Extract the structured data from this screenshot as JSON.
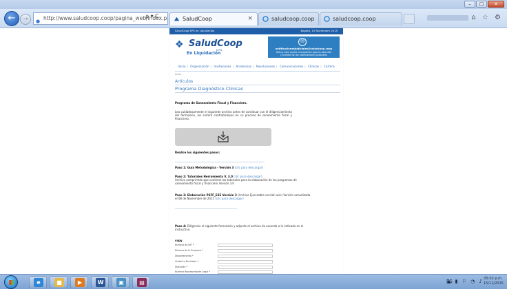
{
  "browser": {
    "address": "http://www.saludcoop.coop/pagina_web/index.php?o",
    "address_domain": "saludcoop.coop",
    "addr_actions": "ρ ▾ C",
    "tabs": [
      {
        "label": "SaludCoop",
        "active": true
      },
      {
        "label": "saludcoop.coop",
        "active": false
      },
      {
        "label": "saludcoop.coop",
        "active": false
      }
    ],
    "window_buttons": {
      "minimize": "–",
      "maximize": "□",
      "close": "✕"
    },
    "toolbar_icons": "⌂ ☆ ⚙"
  },
  "site": {
    "topbar_left": "SaludCoop EPS en Liquidación",
    "topbar_right": "Bogotá, 15 Noviembre 2015",
    "logo_text": "SaludCoop",
    "logo_eps": "E.P.S.",
    "liquidacion": "En Liquidación",
    "notice": {
      "icon": "✉",
      "line1": "notificacionesjudiciales@saludcoop.coop",
      "line2": "Utilice este correo únicamente para la atención",
      "line3": "y trámite de las notificaciones judiciales"
    },
    "nav": [
      "Inicio",
      "Organización",
      "Invitaciones",
      "Acreencias",
      "Resoluciones",
      "Comunicaciones",
      "Clínicas",
      "Cartera"
    ],
    "breadcrumb": "Inicio",
    "section_title": "Artículos",
    "article_title": "Programa Diagnóstico Clínicas",
    "subtitle": "Programa de Saneamiento Fiscal y Financiero.",
    "intro": "Lea cuidadosamente el siguiente archivo antes de continuar con el diligenciamiento del formulario, así evitará contratiempos en su proceso de saneamiento fiscal y financiero.",
    "steps_heading": "Realice los siguientes pasos:",
    "step1_bold": "Paso 1: Guía Metodológica - Versión 3",
    "step1_link": "(clic para descargar)",
    "step2_bold": "Paso 2: Tutoriales Herramienta V. 3.0",
    "step2_link": "(clic para descargar)",
    "step2_text": "Archivo comprimido que contiene los tutoriales para la elaboración de los programas de saneamiento fiscal y financiero Versión 3.0",
    "step3_bold": "Paso 3: Elaboración PSFF_ESE Versión 3",
    "step3_text": "(Archivo Ejecutable versión aún) Versión actualizada el 08 de Noviembre de 2015",
    "step3_link": "(clic para descargar)",
    "step4_bold": "Paso 4:",
    "step4_text": "Diligencie el siguiente formulario y adjunte el archivo de acuerdo a lo indicado en el instructivo.",
    "form_title": "copy",
    "form_fields": [
      "Número de NIT *",
      "Número de la Empresa *",
      "Departamento *",
      "Ciudad o Municipio *",
      "Dirección *",
      "Número Representante Legal *"
    ]
  },
  "taskbar": {
    "apps": [
      "explorer",
      "ie",
      "folder",
      "media",
      "word",
      "network",
      "winrar"
    ],
    "tray": "▲ ▮ ⚐ ◔ ♪",
    "lang": "ES",
    "time": "05:02 p.m.",
    "date": "15/11/2015"
  }
}
